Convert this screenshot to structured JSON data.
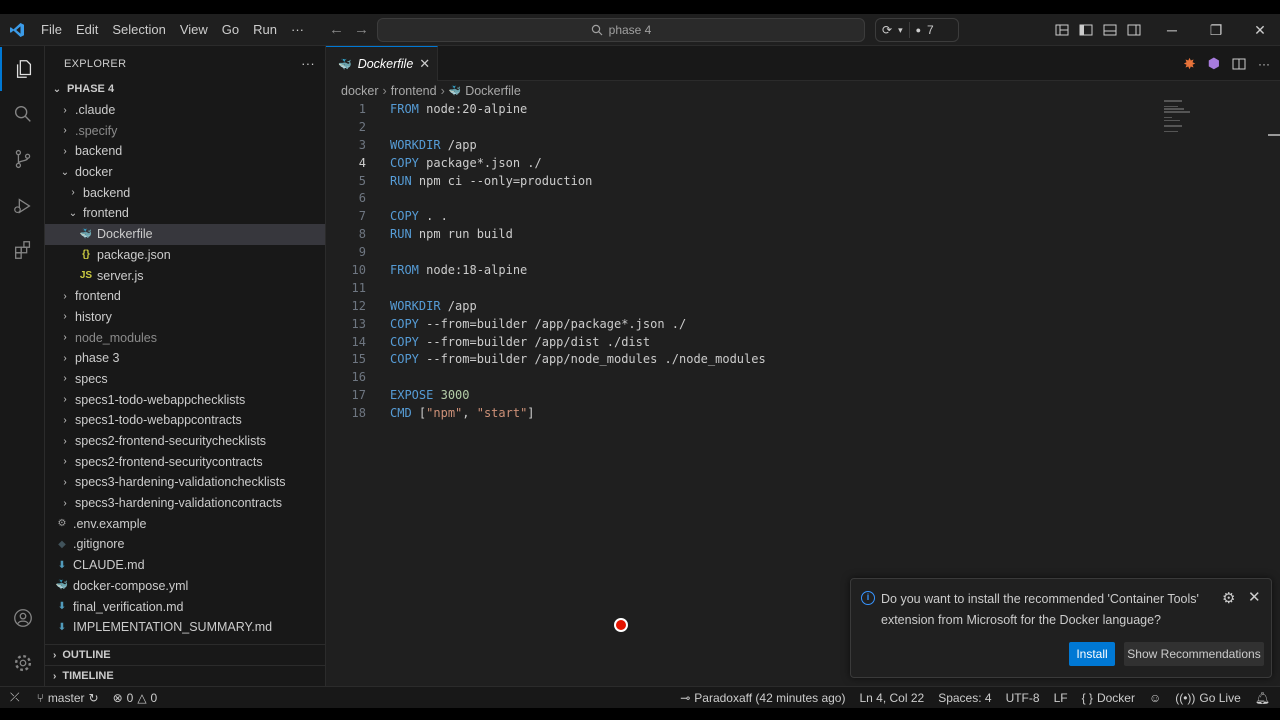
{
  "menu": [
    "File",
    "Edit",
    "Selection",
    "View",
    "Go",
    "Run",
    "···"
  ],
  "search": {
    "text": "phase 4"
  },
  "chat_count": "7",
  "explorer": {
    "title": "EXPLORER",
    "more": "···",
    "root": "PHASE 4",
    "items": [
      {
        "label": ".claude",
        "type": "folder",
        "depth": 1,
        "open": false,
        "dim": false
      },
      {
        "label": ".specify",
        "type": "folder",
        "depth": 1,
        "open": false,
        "dim": true
      },
      {
        "label": "backend",
        "type": "folder",
        "depth": 1,
        "open": false,
        "dim": false
      },
      {
        "label": "docker",
        "type": "folder",
        "depth": 1,
        "open": true,
        "dim": false
      },
      {
        "label": "backend",
        "type": "folder",
        "depth": 2,
        "open": false,
        "dim": false
      },
      {
        "label": "frontend",
        "type": "folder",
        "depth": 2,
        "open": true,
        "dim": false
      },
      {
        "label": "Dockerfile",
        "type": "docker",
        "depth": 3,
        "selected": true
      },
      {
        "label": "package.json",
        "type": "json",
        "depth": 3
      },
      {
        "label": "server.js",
        "type": "js",
        "depth": 3
      },
      {
        "label": "frontend",
        "type": "folder",
        "depth": 1,
        "open": false
      },
      {
        "label": "history",
        "type": "folder",
        "depth": 1,
        "open": false
      },
      {
        "label": "node_modules",
        "type": "folder",
        "depth": 1,
        "open": false,
        "dim": true
      },
      {
        "label": "phase 3",
        "type": "folder",
        "depth": 1,
        "open": false
      },
      {
        "label": "specs",
        "type": "folder",
        "depth": 1,
        "open": false
      },
      {
        "label": "specs1-todo-webappchecklists",
        "type": "folder",
        "depth": 1,
        "open": false
      },
      {
        "label": "specs1-todo-webappcontracts",
        "type": "folder",
        "depth": 1,
        "open": false
      },
      {
        "label": "specs2-frontend-securitychecklists",
        "type": "folder",
        "depth": 1,
        "open": false
      },
      {
        "label": "specs2-frontend-securitycontracts",
        "type": "folder",
        "depth": 1,
        "open": false
      },
      {
        "label": "specs3-hardening-validationchecklists",
        "type": "folder",
        "depth": 1,
        "open": false
      },
      {
        "label": "specs3-hardening-validationcontracts",
        "type": "folder",
        "depth": 1,
        "open": false
      },
      {
        "label": ".env.example",
        "type": "gear",
        "depth": 1
      },
      {
        "label": ".gitignore",
        "type": "git",
        "depth": 1
      },
      {
        "label": "CLAUDE.md",
        "type": "md",
        "depth": 1
      },
      {
        "label": "docker-compose.yml",
        "type": "compose",
        "depth": 1
      },
      {
        "label": "final_verification.md",
        "type": "md",
        "depth": 1
      },
      {
        "label": "IMPLEMENTATION_SUMMARY.md",
        "type": "md",
        "depth": 1
      }
    ],
    "outline": "OUTLINE",
    "timeline": "TIMELINE"
  },
  "tab": {
    "label": "Dockerfile",
    "close": "✕"
  },
  "breadcrumb": [
    "docker",
    "frontend",
    "Dockerfile"
  ],
  "code": {
    "active_line": 4,
    "lines": [
      "FROM node:20-alpine",
      "",
      "WORKDIR /app",
      "COPY package*.json ./",
      "RUN npm ci --only=production",
      "",
      "COPY . .",
      "RUN npm run build",
      "",
      "FROM node:18-alpine",
      "",
      "WORKDIR /app",
      "COPY --from=builder /app/package*.json ./",
      "COPY --from=builder /app/dist ./dist",
      "COPY --from=builder /app/node_modules ./node_modules",
      "",
      "EXPOSE 3000",
      "CMD [\"npm\", \"start\"]"
    ]
  },
  "notification": {
    "message": "Do you want to install the recommended 'Container Tools' extension from Microsoft for the Docker language?",
    "install": "Install",
    "show": "Show Recommendations"
  },
  "status": {
    "branch": "master",
    "errors": "0",
    "warnings": "0",
    "blame": "Paradoxaff (42 minutes ago)",
    "position": "Ln 4, Col 22",
    "spaces": "Spaces: 4",
    "encoding": "UTF-8",
    "eol": "LF",
    "language": "Docker",
    "golive": "Go Live"
  },
  "colors": {
    "accent": "#0078d4",
    "keyword": "#569cd6",
    "string": "#ce9178"
  }
}
